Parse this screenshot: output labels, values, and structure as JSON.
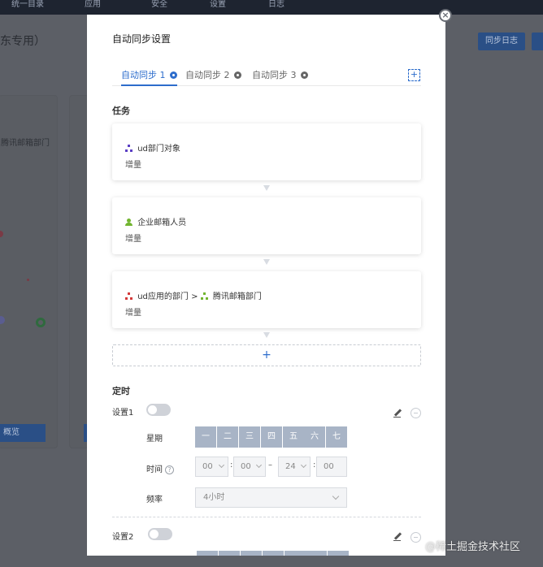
{
  "background": {
    "topbar_items": [
      "统一目录",
      "应用",
      "安全",
      "设置",
      "日志"
    ],
    "title": "东专用）",
    "sync_log_button": "同步日志",
    "card_text": "腾讯邮箱部门",
    "card_button": "概览"
  },
  "modal": {
    "title": "自动同步设置",
    "tabs": [
      {
        "label": "自动同步 1",
        "active": true
      },
      {
        "label": "自动同步 2",
        "active": false
      },
      {
        "label": "自动同步 3",
        "active": false
      }
    ],
    "add_tab_label": "+",
    "tasks_label": "任务",
    "tasks": [
      {
        "icon": "org-chart-icon",
        "icon_color": "#5b3fc4",
        "name": "ud部门对象",
        "subtitle": "增量"
      },
      {
        "icon": "user-icon",
        "icon_color": "#72b530",
        "name": "企业邮箱人员",
        "subtitle": "增量"
      },
      {
        "icon": "org-chart-icon",
        "icon_color": "#d43a3a",
        "name": "ud应用的部门",
        "target_icon_color": "#72b530",
        "arrow": ">",
        "target_name": "腾讯邮箱部门",
        "subtitle": "增量"
      }
    ],
    "add_task_label": "+",
    "schedule_label": "定时",
    "settings": [
      {
        "label": "设置1",
        "enabled": false,
        "weekday_label": "星期",
        "weekdays": [
          "一",
          "二",
          "三",
          "四",
          "五",
          "六",
          "七"
        ],
        "time_label": "时间",
        "time_start_hour": "00",
        "time_start_minute": "00",
        "time_end_hour": "24",
        "time_end_minute": "00",
        "range_separator": "–",
        "colon": ":",
        "frequency_label": "频率",
        "frequency_value": "4小时"
      },
      {
        "label": "设置2",
        "enabled": false
      }
    ]
  },
  "watermark": "@稀土掘金技术社区",
  "colors": {
    "accent": "#2d6dcc",
    "weekday_bg": "#a8b4c6",
    "overlay": "#5c5f66"
  }
}
